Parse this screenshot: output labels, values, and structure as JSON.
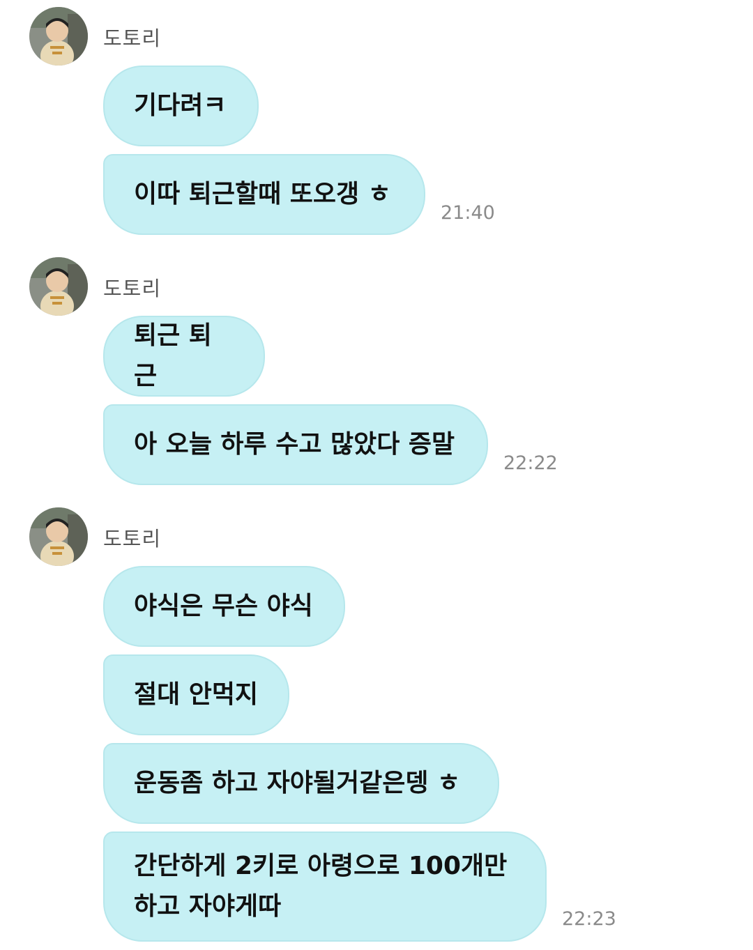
{
  "groups": [
    {
      "sender": "도토리",
      "messages": [
        {
          "text": "기다려ㅋ"
        },
        {
          "text": "이따 퇴근할때 또오갱 ㅎ"
        }
      ],
      "time": "21:40"
    },
    {
      "sender": "도토리",
      "messages": [
        {
          "text": "퇴근 퇴근"
        },
        {
          "text": "아 오늘 하루 수고 많았다 증말"
        }
      ],
      "time": "22:22"
    },
    {
      "sender": "도토리",
      "messages": [
        {
          "text": "야식은 무슨 야식"
        },
        {
          "text": "절대 안먹지"
        },
        {
          "text": "운동좀 하고 자야될거같은뎅 ㅎ"
        },
        {
          "text": "간단하게 2키로 아령으로 100개만\n하고 자야게따"
        }
      ],
      "time": "22:23"
    }
  ],
  "colors": {
    "bubble": "#c6f0f4",
    "bubble_border": "#b6e7ec",
    "time": "#8a8a8a",
    "sender": "#555555"
  },
  "icons": {
    "avatar": "profile-photo-child"
  }
}
